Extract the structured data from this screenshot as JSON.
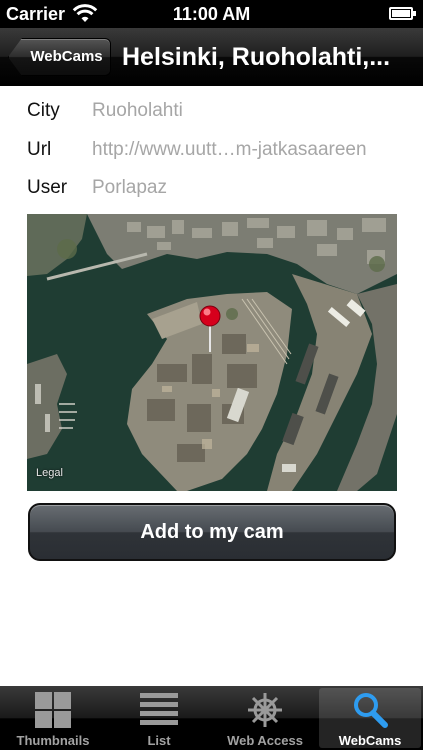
{
  "status_bar": {
    "carrier": "Carrier",
    "time": "11:00 AM"
  },
  "nav_bar": {
    "back_label": "WebCams",
    "title": "Helsinki, Ruoholahti,..."
  },
  "details": {
    "city_label": "City",
    "city_value": "Ruoholahti",
    "url_label": "Url",
    "url_value": "http://www.uutt…m-jatkasaareen",
    "user_label": "User",
    "user_value": "Porlapaz"
  },
  "map": {
    "legal": "Legal",
    "pin_color": "#d6001c"
  },
  "add_button_label": "Add to my cam",
  "tabs": [
    {
      "label": "Thumbnails",
      "icon": "grid-icon",
      "active": false
    },
    {
      "label": "List",
      "icon": "list-icon",
      "active": false
    },
    {
      "label": "Web Access",
      "icon": "ship-wheel-icon",
      "active": false
    },
    {
      "label": "WebCams",
      "icon": "search-icon",
      "active": true
    }
  ],
  "colors": {
    "accent_tab_icon": "#2e9cf0",
    "value_text": "#a6a6a6"
  }
}
